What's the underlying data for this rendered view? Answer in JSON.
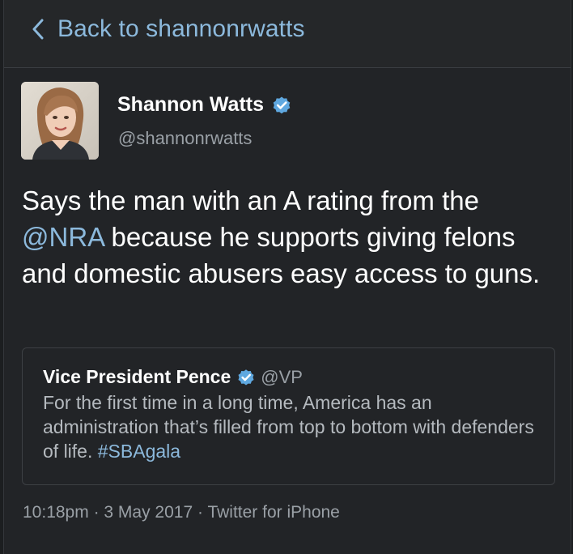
{
  "header": {
    "back_label": "Back to shannonrwatts"
  },
  "tweet": {
    "author_name": "Shannon Watts",
    "author_handle": "@shannonrwatts",
    "text_part1": "Says the man with an A rating from the ",
    "mention": "@NRA",
    "text_part2": " because he supports giving felons and domestic abusers easy access to guns.",
    "timestamp": "10:18pm",
    "date": "3 May 2017",
    "source": "Twitter for iPhone",
    "separator": " · "
  },
  "quote": {
    "author_name": "Vice President Pence",
    "author_handle": "@VP",
    "text": "For the first time in a long time, America has an administration that’s filled from top to bottom with defenders of life. ",
    "hashtag": "#SBAgala"
  },
  "colors": {
    "link": "#8cb9dc",
    "verified": "#5fa8e0",
    "background": "#222427"
  }
}
